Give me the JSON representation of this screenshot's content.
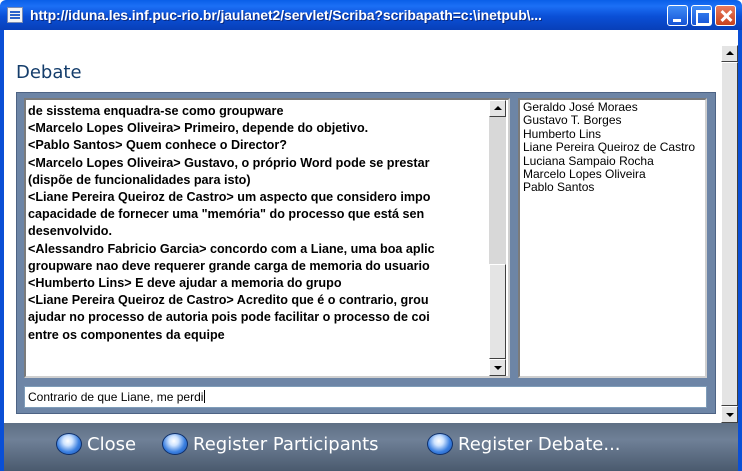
{
  "window": {
    "title": "http://iduna.les.inf.puc-rio.br/jaulanet2/servlet/Scriba?scribapath=c:\\inetpub\\..."
  },
  "heading": "Debate",
  "chat": {
    "lines": [
      "de sisstema enquadra-se como groupware",
      "<Marcelo Lopes Oliveira> Primeiro, depende do objetivo.",
      "<Pablo Santos> Quem conhece o Director?",
      "<Marcelo Lopes Oliveira> Gustavo, o próprio Word pode se prestar",
      "(dispõe de funcionalidades para isto)",
      "<Liane Pereira Queiroz de Castro> um aspecto que considero  impo",
      "capacidade de fornecer uma \"memória\" do processo que  está sen",
      "desenvolvido.",
      "<Alessandro Fabricio Garcia> concordo com a Liane, uma boa aplic",
      "groupware nao deve requerer grande carga de memoria do usuario",
      "<Humberto Lins> E deve ajudar a memoria do grupo",
      "<Liane Pereira Queiroz de Castro> Acredito que é o contrario,  grou",
      "ajudar no processo de autoria pois pode facilitar o  processo de coi",
      "entre os componentes da equipe"
    ]
  },
  "participants": [
    "Geraldo José Moraes",
    "Gustavo T. Borges",
    "Humberto Lins",
    "Liane Pereira Queiroz de Castro",
    "Luciana Sampaio Rocha",
    "Marcelo Lopes Oliveira",
    "Pablo Santos"
  ],
  "input": {
    "value": "Contrario de que Liane, me perdi"
  },
  "footer": {
    "close": "Close",
    "register_participants": "Register Participants",
    "register_debate": "Register Debate..."
  }
}
